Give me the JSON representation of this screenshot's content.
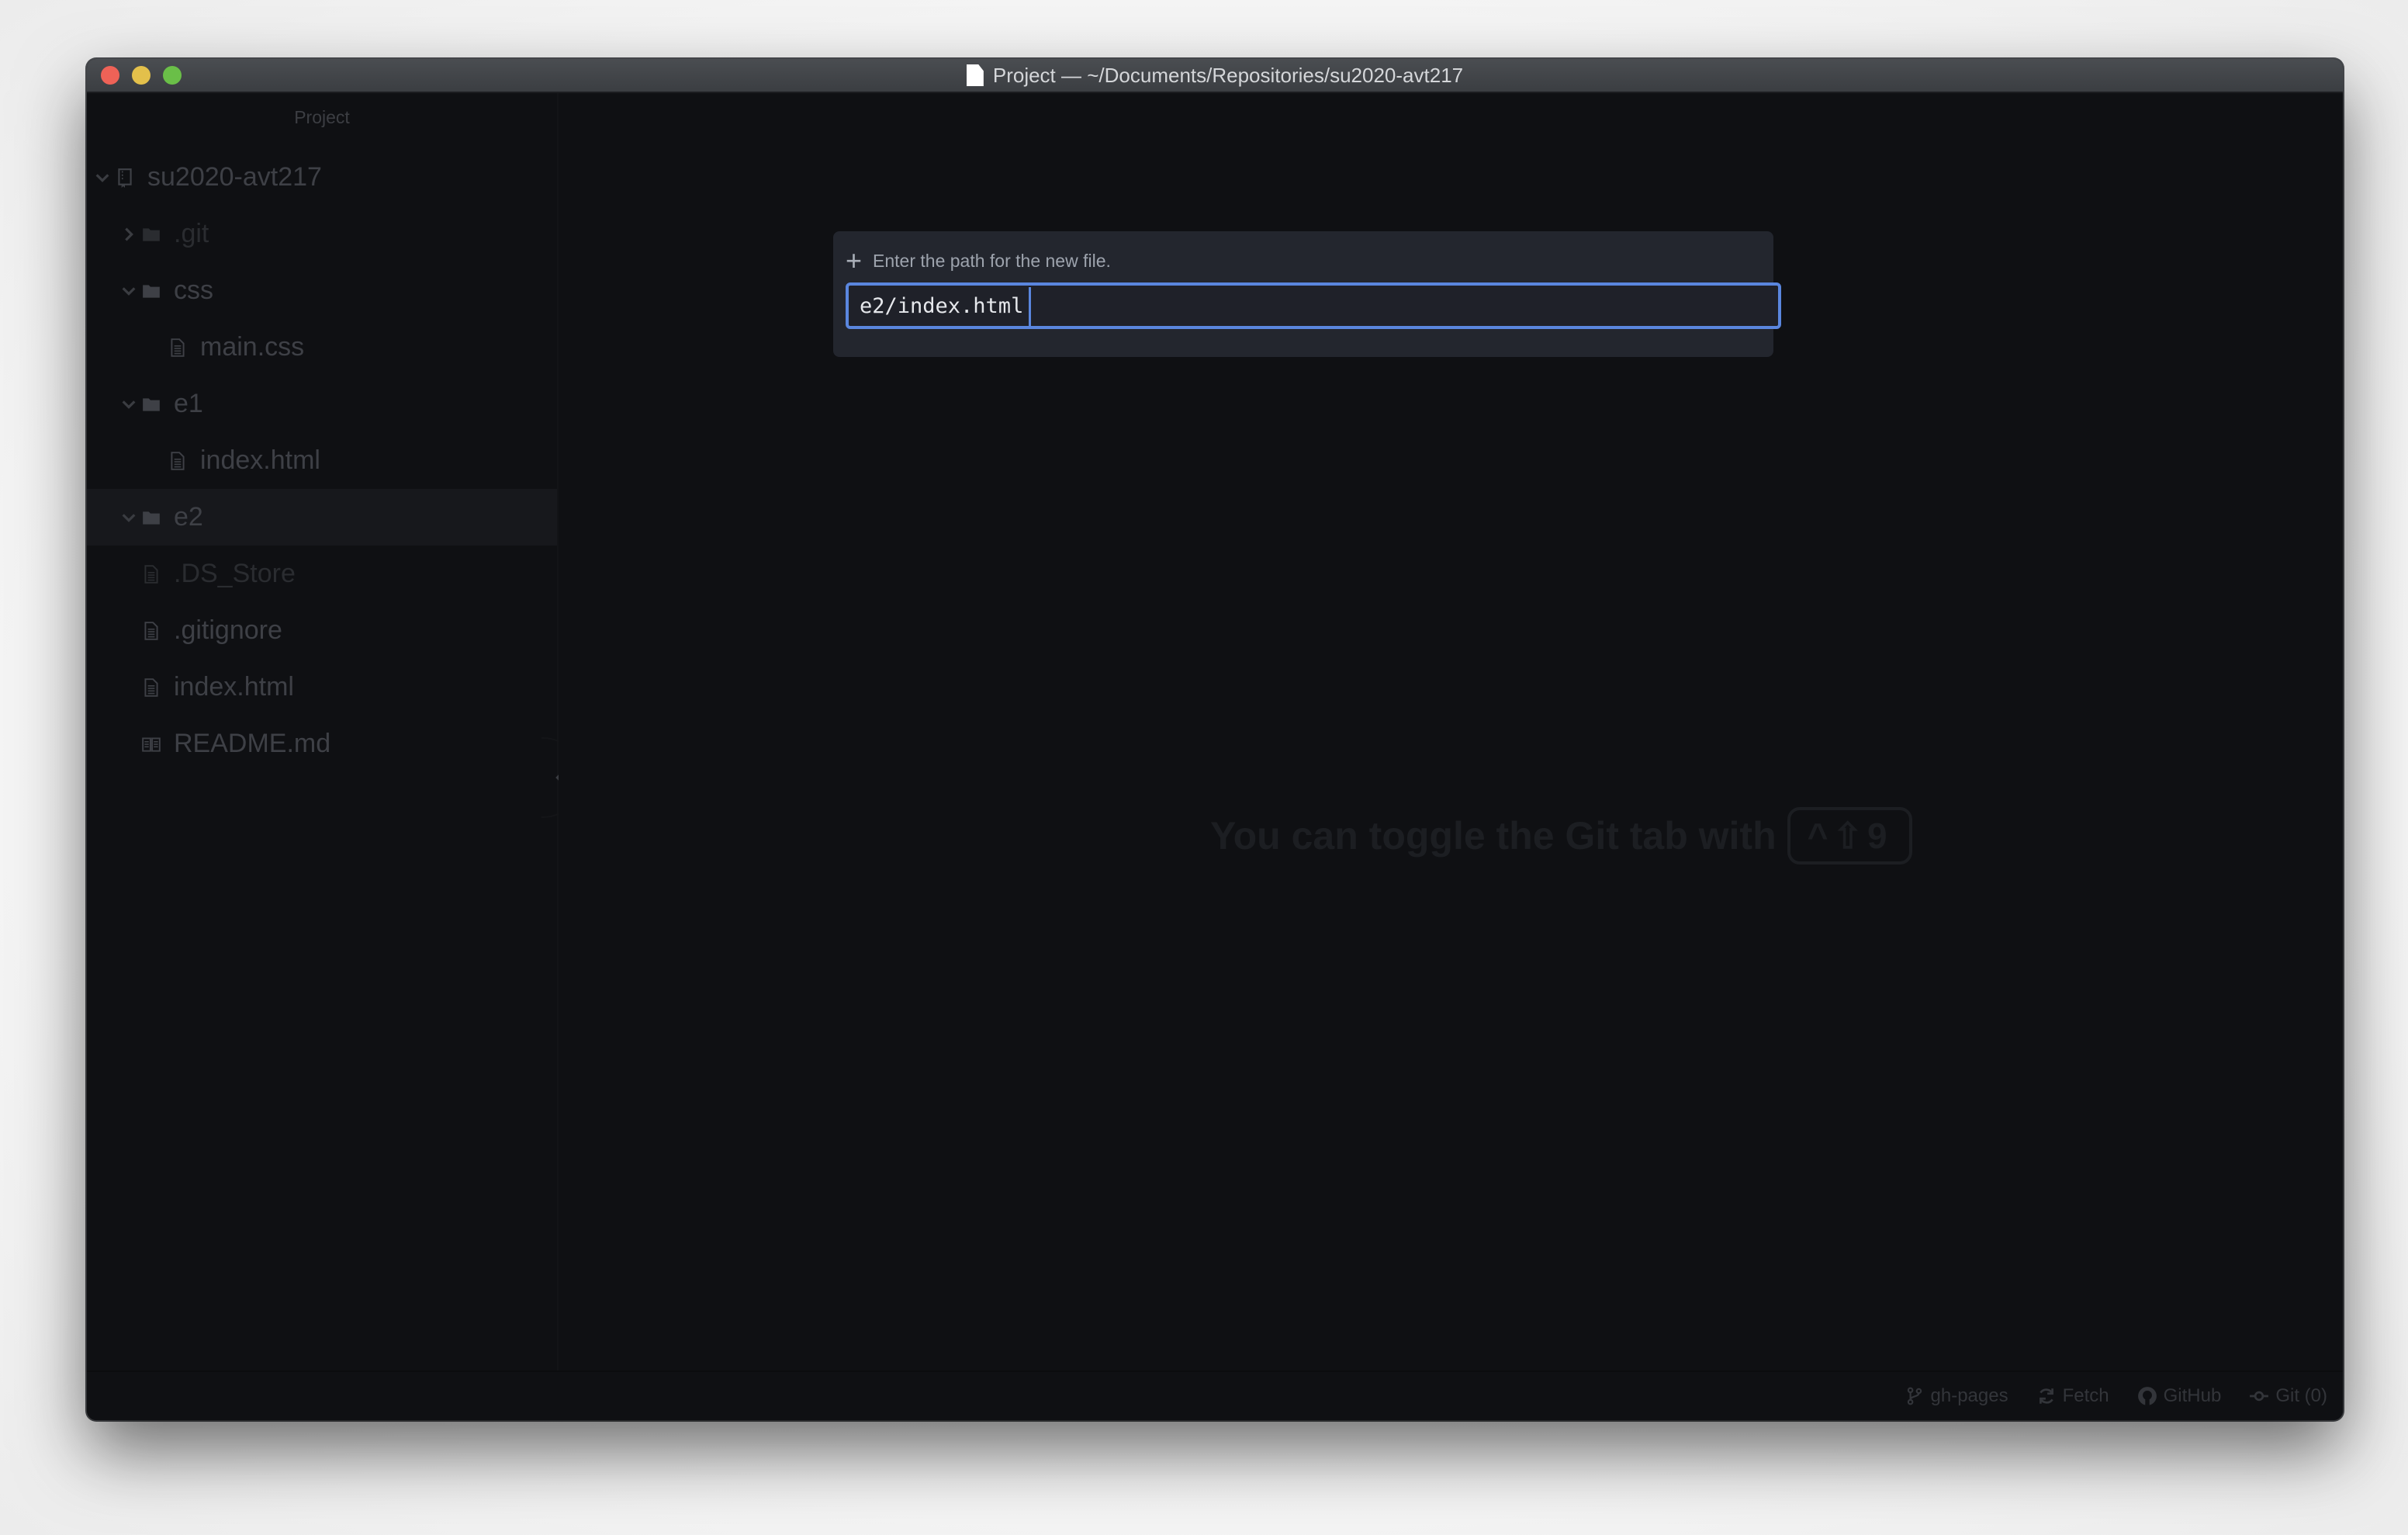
{
  "window": {
    "title": "Project — ~/Documents/Repositories/su2020-avt217",
    "title_icon": "document-icon",
    "controls": [
      "close",
      "minimize",
      "maximize"
    ]
  },
  "sidebar": {
    "header": "Project",
    "collapse_icon": "chevron-left-icon",
    "tree": [
      {
        "label": "su2020-avt217",
        "type": "repo",
        "expanded": true,
        "depth": 0,
        "icon": "repo-icon"
      },
      {
        "label": ".git",
        "type": "folder",
        "expanded": false,
        "depth": 1,
        "icon": "folder-icon",
        "dimmed": true
      },
      {
        "label": "css",
        "type": "folder",
        "expanded": true,
        "depth": 1,
        "icon": "folder-icon"
      },
      {
        "label": "main.css",
        "type": "file",
        "depth": 2,
        "icon": "file-text-icon"
      },
      {
        "label": "e1",
        "type": "folder",
        "expanded": true,
        "depth": 1,
        "icon": "folder-icon"
      },
      {
        "label": "index.html",
        "type": "file",
        "depth": 2,
        "icon": "file-text-icon"
      },
      {
        "label": "e2",
        "type": "folder",
        "expanded": true,
        "depth": 1,
        "icon": "folder-icon",
        "selected": true
      },
      {
        "label": ".DS_Store",
        "type": "file",
        "depth": 1,
        "icon": "file-text-icon",
        "dimmed": true
      },
      {
        "label": ".gitignore",
        "type": "file",
        "depth": 1,
        "icon": "file-text-icon"
      },
      {
        "label": "index.html",
        "type": "file",
        "depth": 1,
        "icon": "file-text-icon"
      },
      {
        "label": "README.md",
        "type": "file",
        "depth": 1,
        "icon": "book-icon"
      }
    ]
  },
  "dialog": {
    "label": "Enter the path for the new file.",
    "icon": "plus-icon",
    "input_value": "e2/index.html",
    "accent": "#5a86de"
  },
  "main": {
    "hint_text": "You can toggle the Git tab with",
    "hint_shortcut": "^⇧9"
  },
  "statusbar": {
    "items": [
      {
        "label": "gh-pages",
        "icon": "git-branch-icon"
      },
      {
        "label": "Fetch",
        "icon": "sync-icon"
      },
      {
        "label": "GitHub",
        "icon": "github-icon"
      },
      {
        "label": "Git (0)",
        "icon": "git-commit-icon"
      }
    ]
  }
}
